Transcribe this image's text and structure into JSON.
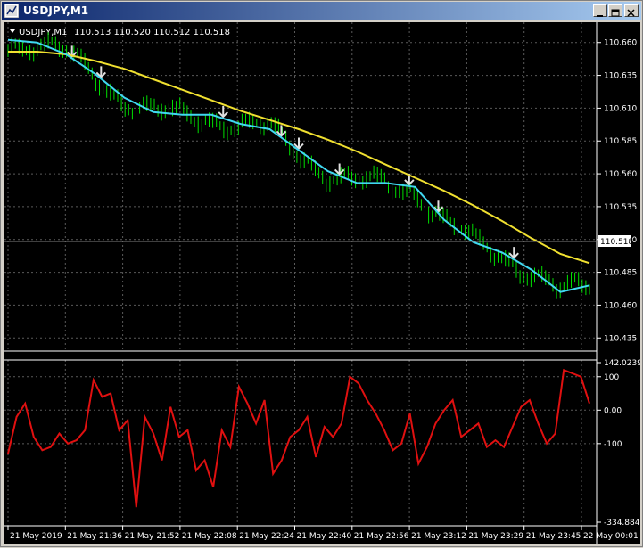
{
  "window": {
    "title": "USDJPY,M1"
  },
  "header": {
    "symbol_label": "USDJPY,M1",
    "ohlc": "110.513 110.520 110.512 110.518"
  },
  "colors": {
    "ma_slow": "#f0e030",
    "ma_fast": "#40d8f0",
    "candles": "#00e000",
    "cci": "#e01010",
    "grid": "#5a5a5a",
    "axis_text": "#ffffff"
  },
  "chart_data": [
    {
      "type": "line",
      "title": "USDJPY,M1",
      "ylim": [
        110.425,
        110.67
      ],
      "price_ticks": [
        "110.660",
        "110.635",
        "110.610",
        "110.585",
        "110.560",
        "110.535",
        "110.510",
        "110.485",
        "110.460",
        "110.435"
      ],
      "current_price": "110.518",
      "x_labels": [
        "21 May 2019",
        "21 May 21:36",
        "21 May 21:52",
        "21 May 22:08",
        "21 May 22:24",
        "21 May 22:40",
        "21 May 22:56",
        "21 May 23:12",
        "21 May 23:29",
        "21 May 23:45",
        "22 May 00:01"
      ],
      "series": [
        {
          "key": "ma_slow",
          "values": [
            110.653,
            110.653,
            110.651,
            110.646,
            110.64,
            110.632,
            110.624,
            110.616,
            110.608,
            110.601,
            110.594,
            110.586,
            110.577,
            110.567,
            110.557,
            110.547,
            110.536,
            110.524,
            110.511,
            110.499,
            110.492
          ]
        },
        {
          "key": "ma_fast",
          "values": [
            110.662,
            110.66,
            110.651,
            110.636,
            110.618,
            110.607,
            110.605,
            110.605,
            110.598,
            110.594,
            110.578,
            110.562,
            110.553,
            110.553,
            110.55,
            110.525,
            110.508,
            110.5,
            110.487,
            110.47,
            110.475
          ]
        }
      ]
    },
    {
      "type": "line",
      "title": "",
      "ylim": [
        -334.8847,
        142.0239
      ],
      "ticks": [
        "142.0239",
        "100",
        "0.00",
        "-100",
        "-334.8847"
      ],
      "series": [
        {
          "key": "cci",
          "values": [
            -130,
            -20,
            20,
            -80,
            -120,
            -110,
            -70,
            -100,
            -90,
            -60,
            90,
            40,
            50,
            -60,
            -30,
            -290,
            -20,
            -70,
            -150,
            10,
            -80,
            -60,
            -180,
            -150,
            -230,
            -60,
            -110,
            70,
            20,
            -40,
            30,
            -190,
            -150,
            -80,
            -60,
            -20,
            -140,
            -50,
            -80,
            -40,
            100,
            80,
            30,
            -10,
            -60,
            -120,
            -100,
            -10,
            -160,
            -110,
            -40,
            0,
            30,
            -80,
            -60,
            -40,
            -110,
            -90,
            -110,
            -50,
            10,
            30,
            -40,
            -100,
            -70,
            120,
            110,
            100,
            20
          ]
        }
      ]
    }
  ]
}
